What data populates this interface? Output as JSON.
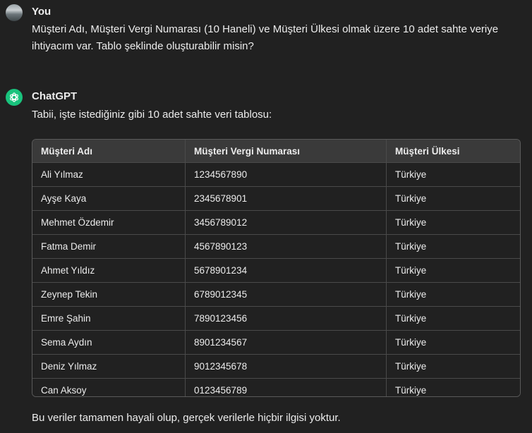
{
  "user_message": {
    "author": "You",
    "lines": [
      "Müşteri Adı, Müşteri Vergi Numarası (10 Haneli) ve Müşteri Ülkesi olmak üzere 10 adet sahte veriye",
      "ihtiyacım var. Tablo şeklinde oluşturabilir misin?"
    ]
  },
  "assistant_message": {
    "author": "ChatGPT",
    "intro": "Tabii, işte istediğiniz gibi 10 adet sahte veri tablosu:",
    "table": {
      "headers": [
        "Müşteri Adı",
        "Müşteri Vergi Numarası",
        "Müşteri Ülkesi"
      ],
      "rows": [
        [
          "Ali Yılmaz",
          "1234567890",
          "Türkiye"
        ],
        [
          "Ayşe Kaya",
          "2345678901",
          "Türkiye"
        ],
        [
          "Mehmet Özdemir",
          "3456789012",
          "Türkiye"
        ],
        [
          "Fatma Demir",
          "4567890123",
          "Türkiye"
        ],
        [
          "Ahmet Yıldız",
          "5678901234",
          "Türkiye"
        ],
        [
          "Zeynep Tekin",
          "6789012345",
          "Türkiye"
        ],
        [
          "Emre Şahin",
          "7890123456",
          "Türkiye"
        ],
        [
          "Sema Aydın",
          "8901234567",
          "Türkiye"
        ],
        [
          "Deniz Yılmaz",
          "9012345678",
          "Türkiye"
        ],
        [
          "Can Aksoy",
          "0123456789",
          "Türkiye"
        ]
      ]
    },
    "outro": "Bu veriler tamamen hayali olup, gerçek verilerle hiçbir ilgisi yoktur."
  },
  "icons": {
    "user_avatar": "user-avatar-photo",
    "assistant_avatar": "openai-logo-icon"
  },
  "colors": {
    "background": "#212121",
    "gpt_avatar": "#19c37d",
    "table_header": "#3a3a3a"
  }
}
